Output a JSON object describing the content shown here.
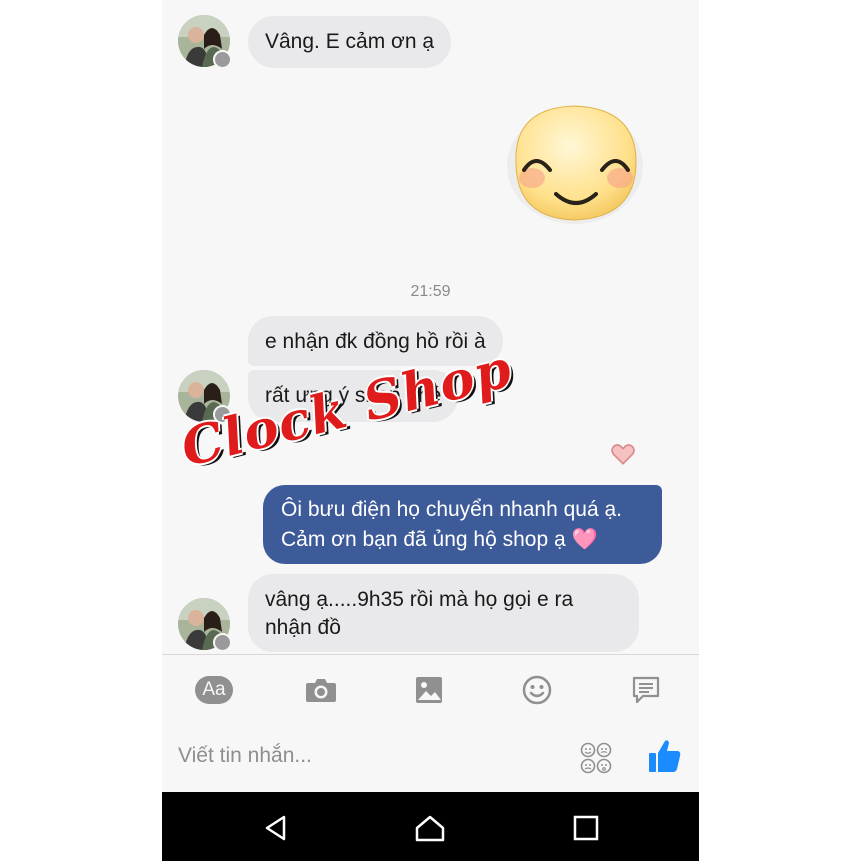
{
  "messages": {
    "m1": "Vâng. E cảm ơn ạ",
    "timestamp": "21:59",
    "m2": "e nhận đk đồng hồ rồi à",
    "m3": "rất ưng ý shop nhé",
    "m4_line1": "Ôi bưu điện họ chuyển nhanh quá ạ.",
    "m4_line2": "Cảm ơn bạn đã ủng hộ shop ạ",
    "m4_emoji": "🩷",
    "m5": "vâng ạ.....9h35 rồi mà họ gọi e ra nhận đồ"
  },
  "watermark": "Clock Shop",
  "composer": {
    "aa_label": "Aa",
    "placeholder": "Viết tin nhắn..."
  },
  "icons": {
    "toolbar": [
      "text-format-icon",
      "camera-icon",
      "image-icon",
      "emoji-icon",
      "chat-icon"
    ],
    "send": "like-thumb-icon",
    "nav": [
      "back-icon",
      "home-icon",
      "recents-icon"
    ]
  },
  "colors": {
    "outgoing_bubble": "#3d5a99",
    "incoming_bubble": "#e9e9eb",
    "accent": "#1a8cff",
    "heart": "#f29a9a",
    "watermark": "#e01b1b"
  }
}
